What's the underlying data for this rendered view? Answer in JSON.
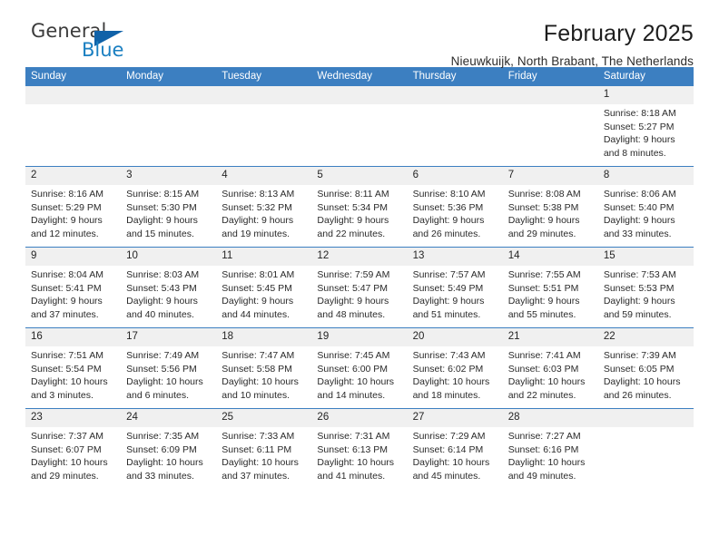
{
  "brand": {
    "name_part1": "General",
    "name_part2": "Blue",
    "logo_icon": "triangle-logo-icon",
    "accent_color": "#1062a8"
  },
  "header": {
    "month_title": "February 2025",
    "location": "Nieuwkuijk, North Brabant, The Netherlands"
  },
  "calendar": {
    "header_color": "#3c7fc1",
    "daynum_bg": "#f0f0f0",
    "weekday_headers": [
      "Sunday",
      "Monday",
      "Tuesday",
      "Wednesday",
      "Thursday",
      "Friday",
      "Saturday"
    ],
    "weeks": [
      [
        {
          "day": "",
          "blank": true,
          "sunrise": "",
          "sunset": "",
          "daylight_line1": "",
          "daylight_line2": ""
        },
        {
          "day": "",
          "blank": true,
          "sunrise": "",
          "sunset": "",
          "daylight_line1": "",
          "daylight_line2": ""
        },
        {
          "day": "",
          "blank": true,
          "sunrise": "",
          "sunset": "",
          "daylight_line1": "",
          "daylight_line2": ""
        },
        {
          "day": "",
          "blank": true,
          "sunrise": "",
          "sunset": "",
          "daylight_line1": "",
          "daylight_line2": ""
        },
        {
          "day": "",
          "blank": true,
          "sunrise": "",
          "sunset": "",
          "daylight_line1": "",
          "daylight_line2": ""
        },
        {
          "day": "",
          "blank": true,
          "sunrise": "",
          "sunset": "",
          "daylight_line1": "",
          "daylight_line2": ""
        },
        {
          "day": "1",
          "blank": false,
          "sunrise": "Sunrise: 8:18 AM",
          "sunset": "Sunset: 5:27 PM",
          "daylight_line1": "Daylight: 9 hours",
          "daylight_line2": "and 8 minutes."
        }
      ],
      [
        {
          "day": "2",
          "blank": false,
          "sunrise": "Sunrise: 8:16 AM",
          "sunset": "Sunset: 5:29 PM",
          "daylight_line1": "Daylight: 9 hours",
          "daylight_line2": "and 12 minutes."
        },
        {
          "day": "3",
          "blank": false,
          "sunrise": "Sunrise: 8:15 AM",
          "sunset": "Sunset: 5:30 PM",
          "daylight_line1": "Daylight: 9 hours",
          "daylight_line2": "and 15 minutes."
        },
        {
          "day": "4",
          "blank": false,
          "sunrise": "Sunrise: 8:13 AM",
          "sunset": "Sunset: 5:32 PM",
          "daylight_line1": "Daylight: 9 hours",
          "daylight_line2": "and 19 minutes."
        },
        {
          "day": "5",
          "blank": false,
          "sunrise": "Sunrise: 8:11 AM",
          "sunset": "Sunset: 5:34 PM",
          "daylight_line1": "Daylight: 9 hours",
          "daylight_line2": "and 22 minutes."
        },
        {
          "day": "6",
          "blank": false,
          "sunrise": "Sunrise: 8:10 AM",
          "sunset": "Sunset: 5:36 PM",
          "daylight_line1": "Daylight: 9 hours",
          "daylight_line2": "and 26 minutes."
        },
        {
          "day": "7",
          "blank": false,
          "sunrise": "Sunrise: 8:08 AM",
          "sunset": "Sunset: 5:38 PM",
          "daylight_line1": "Daylight: 9 hours",
          "daylight_line2": "and 29 minutes."
        },
        {
          "day": "8",
          "blank": false,
          "sunrise": "Sunrise: 8:06 AM",
          "sunset": "Sunset: 5:40 PM",
          "daylight_line1": "Daylight: 9 hours",
          "daylight_line2": "and 33 minutes."
        }
      ],
      [
        {
          "day": "9",
          "blank": false,
          "sunrise": "Sunrise: 8:04 AM",
          "sunset": "Sunset: 5:41 PM",
          "daylight_line1": "Daylight: 9 hours",
          "daylight_line2": "and 37 minutes."
        },
        {
          "day": "10",
          "blank": false,
          "sunrise": "Sunrise: 8:03 AM",
          "sunset": "Sunset: 5:43 PM",
          "daylight_line1": "Daylight: 9 hours",
          "daylight_line2": "and 40 minutes."
        },
        {
          "day": "11",
          "blank": false,
          "sunrise": "Sunrise: 8:01 AM",
          "sunset": "Sunset: 5:45 PM",
          "daylight_line1": "Daylight: 9 hours",
          "daylight_line2": "and 44 minutes."
        },
        {
          "day": "12",
          "blank": false,
          "sunrise": "Sunrise: 7:59 AM",
          "sunset": "Sunset: 5:47 PM",
          "daylight_line1": "Daylight: 9 hours",
          "daylight_line2": "and 48 minutes."
        },
        {
          "day": "13",
          "blank": false,
          "sunrise": "Sunrise: 7:57 AM",
          "sunset": "Sunset: 5:49 PM",
          "daylight_line1": "Daylight: 9 hours",
          "daylight_line2": "and 51 minutes."
        },
        {
          "day": "14",
          "blank": false,
          "sunrise": "Sunrise: 7:55 AM",
          "sunset": "Sunset: 5:51 PM",
          "daylight_line1": "Daylight: 9 hours",
          "daylight_line2": "and 55 minutes."
        },
        {
          "day": "15",
          "blank": false,
          "sunrise": "Sunrise: 7:53 AM",
          "sunset": "Sunset: 5:53 PM",
          "daylight_line1": "Daylight: 9 hours",
          "daylight_line2": "and 59 minutes."
        }
      ],
      [
        {
          "day": "16",
          "blank": false,
          "sunrise": "Sunrise: 7:51 AM",
          "sunset": "Sunset: 5:54 PM",
          "daylight_line1": "Daylight: 10 hours",
          "daylight_line2": "and 3 minutes."
        },
        {
          "day": "17",
          "blank": false,
          "sunrise": "Sunrise: 7:49 AM",
          "sunset": "Sunset: 5:56 PM",
          "daylight_line1": "Daylight: 10 hours",
          "daylight_line2": "and 6 minutes."
        },
        {
          "day": "18",
          "blank": false,
          "sunrise": "Sunrise: 7:47 AM",
          "sunset": "Sunset: 5:58 PM",
          "daylight_line1": "Daylight: 10 hours",
          "daylight_line2": "and 10 minutes."
        },
        {
          "day": "19",
          "blank": false,
          "sunrise": "Sunrise: 7:45 AM",
          "sunset": "Sunset: 6:00 PM",
          "daylight_line1": "Daylight: 10 hours",
          "daylight_line2": "and 14 minutes."
        },
        {
          "day": "20",
          "blank": false,
          "sunrise": "Sunrise: 7:43 AM",
          "sunset": "Sunset: 6:02 PM",
          "daylight_line1": "Daylight: 10 hours",
          "daylight_line2": "and 18 minutes."
        },
        {
          "day": "21",
          "blank": false,
          "sunrise": "Sunrise: 7:41 AM",
          "sunset": "Sunset: 6:03 PM",
          "daylight_line1": "Daylight: 10 hours",
          "daylight_line2": "and 22 minutes."
        },
        {
          "day": "22",
          "blank": false,
          "sunrise": "Sunrise: 7:39 AM",
          "sunset": "Sunset: 6:05 PM",
          "daylight_line1": "Daylight: 10 hours",
          "daylight_line2": "and 26 minutes."
        }
      ],
      [
        {
          "day": "23",
          "blank": false,
          "sunrise": "Sunrise: 7:37 AM",
          "sunset": "Sunset: 6:07 PM",
          "daylight_line1": "Daylight: 10 hours",
          "daylight_line2": "and 29 minutes."
        },
        {
          "day": "24",
          "blank": false,
          "sunrise": "Sunrise: 7:35 AM",
          "sunset": "Sunset: 6:09 PM",
          "daylight_line1": "Daylight: 10 hours",
          "daylight_line2": "and 33 minutes."
        },
        {
          "day": "25",
          "blank": false,
          "sunrise": "Sunrise: 7:33 AM",
          "sunset": "Sunset: 6:11 PM",
          "daylight_line1": "Daylight: 10 hours",
          "daylight_line2": "and 37 minutes."
        },
        {
          "day": "26",
          "blank": false,
          "sunrise": "Sunrise: 7:31 AM",
          "sunset": "Sunset: 6:13 PM",
          "daylight_line1": "Daylight: 10 hours",
          "daylight_line2": "and 41 minutes."
        },
        {
          "day": "27",
          "blank": false,
          "sunrise": "Sunrise: 7:29 AM",
          "sunset": "Sunset: 6:14 PM",
          "daylight_line1": "Daylight: 10 hours",
          "daylight_line2": "and 45 minutes."
        },
        {
          "day": "28",
          "blank": false,
          "sunrise": "Sunrise: 7:27 AM",
          "sunset": "Sunset: 6:16 PM",
          "daylight_line1": "Daylight: 10 hours",
          "daylight_line2": "and 49 minutes."
        },
        {
          "day": "",
          "blank": true,
          "sunrise": "",
          "sunset": "",
          "daylight_line1": "",
          "daylight_line2": ""
        }
      ]
    ]
  }
}
